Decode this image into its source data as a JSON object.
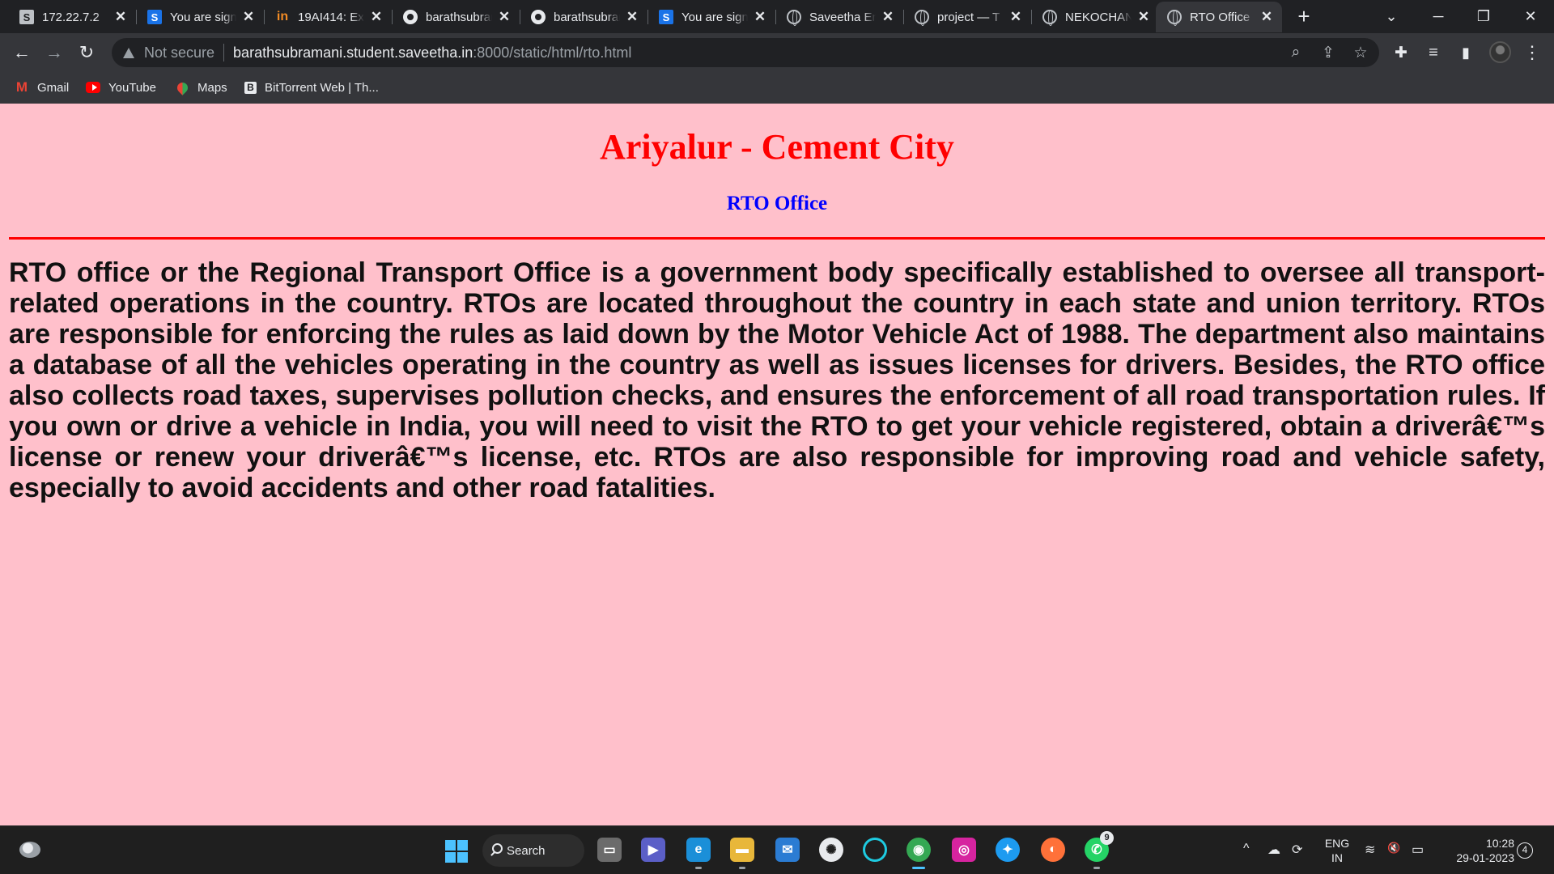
{
  "tabs": [
    {
      "title": "172.22.7.2",
      "favicon": "S",
      "icon": "s-icon",
      "close": "✕"
    },
    {
      "title": "You are signed in",
      "favicon": "S",
      "icon": "s-blue-icon",
      "close": "✕"
    },
    {
      "title": "19AI414: Ex",
      "favicon": "in",
      "icon": "in-icon",
      "close": "✕"
    },
    {
      "title": "barathsubramani",
      "favicon": "",
      "icon": "github-icon",
      "close": "✕"
    },
    {
      "title": "barathsubramani",
      "favicon": "",
      "icon": "github-icon",
      "close": "✕"
    },
    {
      "title": "You are signed in",
      "favicon": "S",
      "icon": "s-blue-icon",
      "close": "✕"
    },
    {
      "title": "Saveetha Engineering",
      "favicon": "",
      "icon": "globe-icon",
      "close": "✕"
    },
    {
      "title": "project — T",
      "favicon": "",
      "icon": "globe-icon",
      "close": "✕"
    },
    {
      "title": "NEKOCHAN",
      "favicon": "",
      "icon": "globe-icon",
      "close": "✕"
    },
    {
      "title": "RTO Office",
      "favicon": "",
      "icon": "globe-icon",
      "close": "✕"
    }
  ],
  "browser": {
    "new_tab": "+",
    "tab_search": "⌄",
    "minimize": "─",
    "restore": "❐",
    "close": "✕",
    "back": "←",
    "forward": "→",
    "reload": "↻",
    "not_secure": "Not secure",
    "url_host": "barathsubramani.student.saveetha.in",
    "url_path": ":8000/static/html/rto.html",
    "zoom": "⌕",
    "share": "⇪",
    "star": "☆",
    "extensions": "✚",
    "reading_list": "≡",
    "side_panel": "▮",
    "menu": "⋮"
  },
  "bookmarks": [
    {
      "label": "Gmail",
      "favicon": "M",
      "icon": "gmail-icon"
    },
    {
      "label": "YouTube",
      "favicon": "",
      "icon": "youtube-icon"
    },
    {
      "label": "Maps",
      "favicon": "",
      "icon": "maps-icon"
    },
    {
      "label": "BitTorrent Web | Th...",
      "favicon": "B",
      "icon": "bittorrent-icon"
    }
  ],
  "page": {
    "heading": "Ariyalur - Cement City",
    "subheading": "RTO Office",
    "paragraph": "RTO office or the Regional Transport Office is a government body specifically established to oversee all transport-related operations in the country. RTOs are located throughout the country in each state and union territory. RTOs are responsible for enforcing the rules as laid down by the Motor Vehicle Act of 1988. The department also maintains a database of all the vehicles operating in the country as well as issues licenses for drivers. Besides, the RTO office also collects road taxes, supervises pollution checks, and ensures the enforcement of all road transportation rules. If you own or drive a vehicle in India, you will need to visit the RTO to get your vehicle registered, obtain a driverâ€™s license or renew your driverâ€™s license, etc. RTOs are also responsible for improving road and vehicle safety, especially to avoid accidents and other road fatalities."
  },
  "taskbar": {
    "search_label": "Search",
    "apps": [
      {
        "icon": "task-view-icon",
        "glyph": "▭",
        "color": "#6b6b6b"
      },
      {
        "icon": "teams-meet-icon",
        "glyph": "▶",
        "color": "#5b5fc7"
      },
      {
        "icon": "edge-icon",
        "glyph": "e",
        "color": "#1b8fd8"
      },
      {
        "icon": "file-explorer-icon",
        "glyph": "▬",
        "color": "#e8b73a"
      },
      {
        "icon": "mail-icon",
        "glyph": "✉",
        "color": "#2b7cd3"
      },
      {
        "icon": "chatgpt-icon",
        "glyph": "✺",
        "color": "#e8eaed"
      },
      {
        "icon": "cortana-icon",
        "glyph": "○",
        "color": "#1f1f1f"
      },
      {
        "icon": "chrome-icon",
        "glyph": "◉",
        "color": "#34a853"
      },
      {
        "icon": "instagram-icon",
        "glyph": "◎",
        "color": "#d6249f"
      },
      {
        "icon": "twitter-icon",
        "glyph": "✦",
        "color": "#1d9bf0"
      },
      {
        "icon": "firefox-icon",
        "glyph": "◐",
        "color": "#ff7139"
      },
      {
        "icon": "whatsapp-icon",
        "glyph": "✆",
        "color": "#25d366"
      }
    ],
    "whatsapp_badge": "9",
    "tray_chevron": "^",
    "onedrive": "☁",
    "sync": "⟳",
    "lang_line1": "ENG",
    "lang_line2": "IN",
    "wifi": "≋",
    "volume": "🔇",
    "battery": "▭",
    "time": "10:28",
    "date": "29-01-2023",
    "notifications": "4"
  }
}
